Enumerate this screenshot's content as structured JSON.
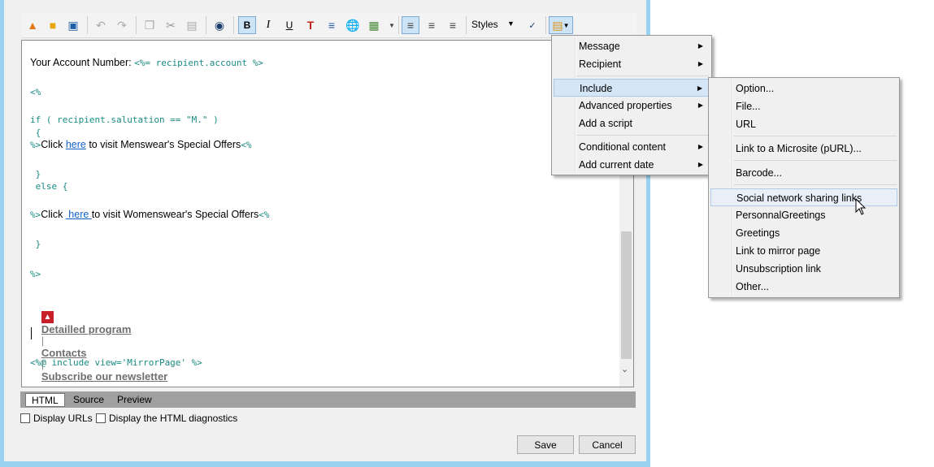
{
  "toolbar": {
    "icons": [
      "new-file-icon",
      "open-folder-icon",
      "save-icon",
      "undo-icon",
      "redo-icon",
      "copy-icon",
      "cut-icon",
      "paste-icon",
      "binoculars-icon",
      "bold-icon",
      "italic-icon",
      "underline-icon",
      "text-color-icon",
      "list-icon",
      "link-icon",
      "image-icon",
      "align-left-icon",
      "align-center-icon",
      "align-right-icon",
      "spellcheck-icon",
      "insert-menu-icon"
    ],
    "bold": "B",
    "italic": "I",
    "underline": "U",
    "styles_label": "Styles"
  },
  "editor": {
    "account_label": "Your Account Number: ",
    "account_code": "<%= recipient.account %>",
    "open_tag": "<%",
    "if_line": "if ( recipient.salutation == \"M.\" )",
    "brace_open": " {",
    "mens_prefix": "%>",
    "mens_click": "Click ",
    "mens_here": "here",
    "mens_rest": " to visit Menswear's Special Offers",
    "mens_suffix": "<%",
    "brace_close": " }",
    "else_line": " else {",
    "womens_prefix": "%>",
    "womens_click": "Click ",
    "womens_here": " here ",
    "womens_rest": "to visit Womenswear's Special Offers",
    "womens_suffix": "<%",
    "brace_close2": " }",
    "close_tag": "%>",
    "footer_link1": "Detailled program",
    "footer_sep1": "|",
    "footer_link2": "Contacts",
    "footer_sep2": "|",
    "footer_link3": "Subscribe our newsletter",
    "include_line": "<%@ include view='MirrorPage' %>"
  },
  "tabs": [
    "HTML",
    "Source",
    "Preview"
  ],
  "options": {
    "display_urls": "Display URLs",
    "display_diag": "Display the HTML diagnostics"
  },
  "buttons": {
    "save": "Save",
    "cancel": "Cancel"
  },
  "menu": {
    "items": [
      "Message",
      "Recipient",
      "Include",
      "Advanced properties",
      "Add a script",
      "Conditional content",
      "Add current date"
    ]
  },
  "submenu": {
    "items": [
      "Option...",
      "File...",
      "URL",
      "Link to a Microsite (pURL)...",
      "Barcode...",
      "Social network sharing links",
      "PersonnalGreetings",
      "Greetings",
      "Link to mirror page",
      "Unsubscription link",
      "Other..."
    ]
  },
  "colors": {
    "accent": "#1a8a83",
    "link": "#1060c8",
    "frame": "#9ad3f2",
    "highlight": "#d5e6f7"
  }
}
